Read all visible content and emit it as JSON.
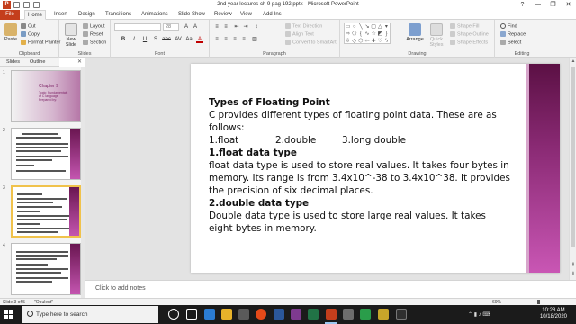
{
  "window": {
    "title": "2nd year lectures ch 9 pag 192.pptx - Microsoft PowerPoint",
    "app_icon": "P",
    "controls": [
      "?",
      "—",
      "❐",
      "✕"
    ]
  },
  "ribbon_tabs": [
    "File",
    "Home",
    "Insert",
    "Design",
    "Transitions",
    "Animations",
    "Slide Show",
    "Review",
    "View",
    "Add-Ins"
  ],
  "ribbon": {
    "clipboard": {
      "label": "Clipboard",
      "paste": "Paste",
      "cut": "Cut",
      "copy": "Copy",
      "format_painter": "Format Painter"
    },
    "slides": {
      "label": "Slides",
      "new_slide": "New Slide",
      "layout": "Layout",
      "reset": "Reset",
      "section": "Section"
    },
    "font": {
      "label": "Font",
      "size": "28",
      "buttons": [
        "B",
        "I",
        "U",
        "S",
        "abc",
        "AV",
        "Aa",
        "A"
      ]
    },
    "paragraph": {
      "label": "Paragraph",
      "text_direction": "Text Direction",
      "align_text": "Align Text",
      "convert_smartart": "Convert to SmartArt"
    },
    "drawing": {
      "label": "Drawing",
      "arrange": "Arrange",
      "quick_styles": "Quick Styles",
      "shape_fill": "Shape Fill",
      "shape_outline": "Shape Outline",
      "shape_effects": "Shape Effects"
    },
    "editing": {
      "label": "Editing",
      "find": "Find",
      "replace": "Replace",
      "select": "Select"
    }
  },
  "pane": {
    "tabs": [
      "Slides",
      "Outline"
    ],
    "close": "✕",
    "thumb_numbers": [
      "1",
      "2",
      "3",
      "4"
    ]
  },
  "thumb1": {
    "title": "Chapter 9",
    "subtitle": "Topic: Fundamentals of C language Prepared by:"
  },
  "slide": {
    "heading": "Types of Floating Point",
    "intro": "C provides different types of floating point data. These are as follows:",
    "types": [
      "1.float",
      "2.double",
      "3.long double"
    ],
    "float_heading": "1.float data type",
    "float_body": "float data type is used to store real values. It takes four bytes in memory. Its range is from 3.4x10^-38 to 3.4x10^38. It provides the precision of six decimal places.",
    "double_heading": "2.double data type",
    "double_body": "Double data type is used to store large real values. It takes eight bytes in memory."
  },
  "notes": {
    "placeholder": "Click to add notes"
  },
  "status": {
    "slide_info": "Slide 3 of 5",
    "theme": "\"Opulent\"",
    "zoom": "69%"
  },
  "taskbar": {
    "search_placeholder": "Type here to search",
    "time": "10:28 AM",
    "date": "10/18/2020"
  }
}
